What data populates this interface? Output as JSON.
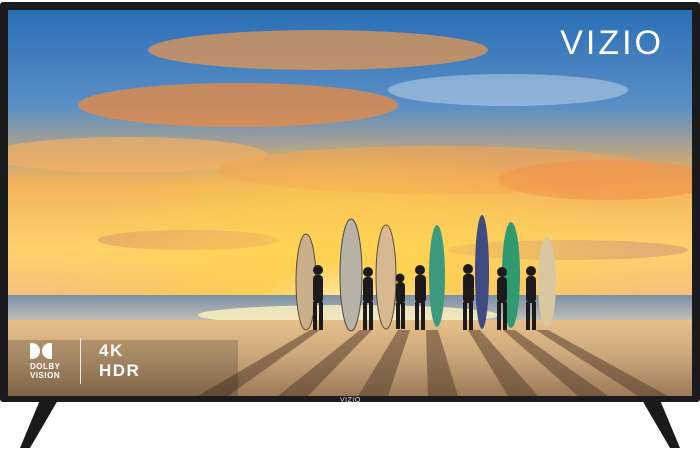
{
  "product": {
    "brand_logo": "VIZIO",
    "bezel_logo": "VIZIO",
    "badges": {
      "dolby_line1": "DOLBY",
      "dolby_line2": "VISION",
      "resolution": "4K",
      "hdr": "HDR"
    }
  },
  "scene": {
    "description_icon": "beach-sunset-surfers",
    "surfer_count": 7
  },
  "colors": {
    "bezel": "#1b1b1d",
    "sky_top": "#2a6fb6",
    "sun_glow": "#ffd24a",
    "sand": "#c9a57a"
  }
}
